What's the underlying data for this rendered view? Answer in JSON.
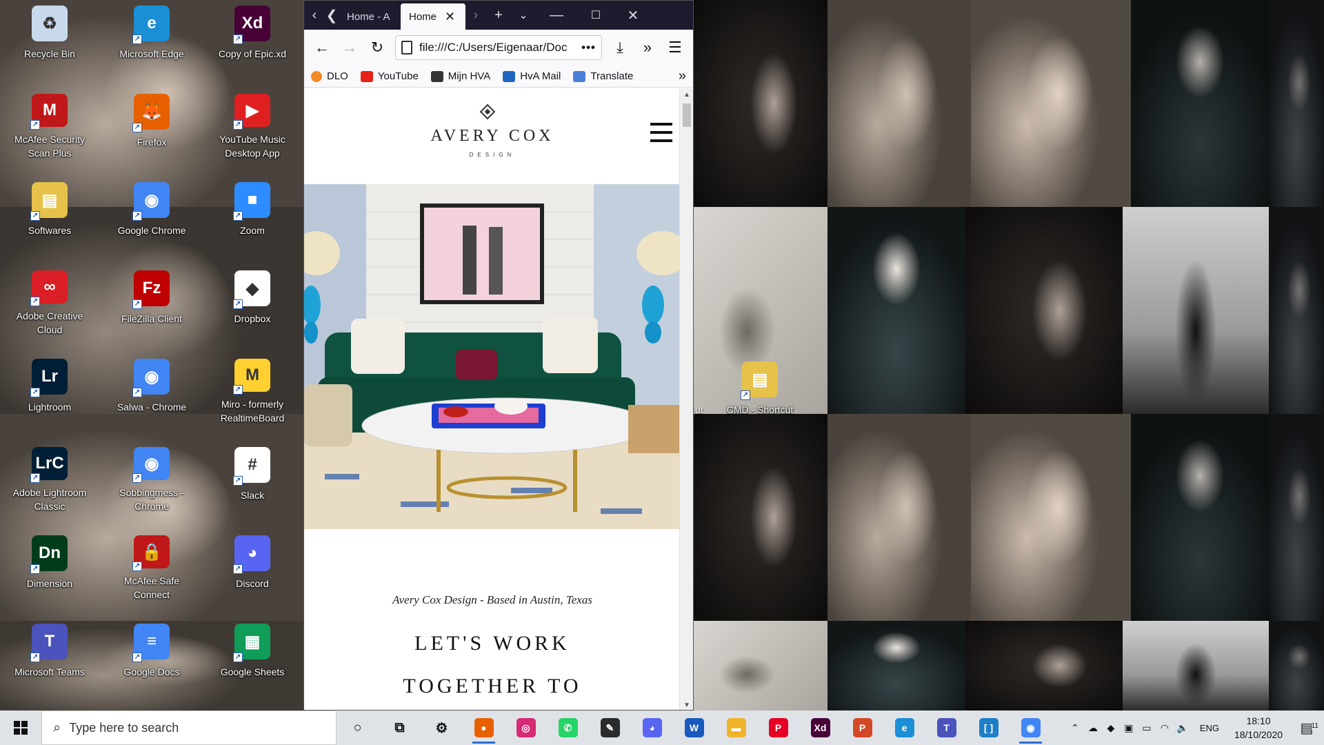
{
  "desktop": {
    "icons": [
      {
        "label": "Recycle Bin",
        "icon": "recycle-bin-icon",
        "color": "#c9d9ec",
        "glyph": "♻"
      },
      {
        "label": "Microsoft Edge",
        "icon": "edge-icon",
        "color": "#1b8fd6",
        "glyph": "e"
      },
      {
        "label": "Copy of Epic.xd",
        "icon": "xd-file-icon",
        "color": "#470137",
        "glyph": "Xd"
      },
      {
        "label": "McAfee Security Scan Plus",
        "icon": "mcafee-icon",
        "color": "#c01818",
        "glyph": "M"
      },
      {
        "label": "Firefox",
        "icon": "firefox-icon",
        "color": "#e66000",
        "glyph": "🦊"
      },
      {
        "label": "YouTube Music Desktop App",
        "icon": "youtube-music-icon",
        "color": "#e02020",
        "glyph": "▶"
      },
      {
        "label": "Softwares",
        "icon": "folder-icon",
        "color": "#e6c24a",
        "glyph": "▤"
      },
      {
        "label": "Google Chrome",
        "icon": "chrome-icon",
        "color": "#4285f4",
        "glyph": "◉"
      },
      {
        "label": "Zoom",
        "icon": "zoom-icon",
        "color": "#2d8cff",
        "glyph": "■"
      },
      {
        "label": "Adobe Creative Cloud",
        "icon": "creative-cloud-icon",
        "color": "#da1f26",
        "glyph": "∞"
      },
      {
        "label": "FileZilla Client",
        "icon": "filezilla-icon",
        "color": "#bf0000",
        "glyph": "Fz"
      },
      {
        "label": "Dropbox",
        "icon": "dropbox-icon",
        "color": "#ffffff",
        "glyph": "◆"
      },
      {
        "label": "Lightroom",
        "icon": "lightroom-icon",
        "color": "#001e36",
        "glyph": "Lr"
      },
      {
        "label": "Salwa - Chrome",
        "icon": "chrome-profile-icon",
        "color": "#4285f4",
        "glyph": "◉"
      },
      {
        "label": "Miro - formerly RealtimeBoard",
        "icon": "miro-icon",
        "color": "#ffd02f",
        "glyph": "M"
      },
      {
        "label": "Adobe Lightroom Classic",
        "icon": "lightroom-classic-icon",
        "color": "#001e36",
        "glyph": "LrC"
      },
      {
        "label": "Sobbingmess - Chrome",
        "icon": "chrome-profile-icon",
        "color": "#4285f4",
        "glyph": "◉"
      },
      {
        "label": "Slack",
        "icon": "slack-icon",
        "color": "#ffffff",
        "glyph": "#"
      },
      {
        "label": "Dimension",
        "icon": "dimension-icon",
        "color": "#003b1a",
        "glyph": "Dn"
      },
      {
        "label": "McAfee Safe Connect",
        "icon": "mcafee-safe-connect-icon",
        "color": "#c01818",
        "glyph": "🔒"
      },
      {
        "label": "Discord",
        "icon": "discord-icon",
        "color": "#5865f2",
        "glyph": "◕"
      },
      {
        "label": "Microsoft Teams",
        "icon": "teams-icon",
        "color": "#4b53bc",
        "glyph": "T"
      },
      {
        "label": "Google Docs",
        "icon": "google-docs-icon",
        "color": "#4285f4",
        "glyph": "≡"
      },
      {
        "label": "Google Sheets",
        "icon": "google-sheets-icon",
        "color": "#0f9d58",
        "glyph": "▦"
      }
    ],
    "extra_icon": {
      "label": "CMD - Shortcut",
      "icon": "folder-icon",
      "color": "#e6c24a",
      "glyph": "▤"
    },
    "partial_label": "ut"
  },
  "browser": {
    "tabs": [
      {
        "label": "Home - A"
      },
      {
        "label": "Home",
        "active": true
      }
    ],
    "url": "file:///C:/Users/Eigenaar/Doc",
    "bookmarks": [
      {
        "label": "DLO",
        "icon": "dlo-icon",
        "color": "#f08a24"
      },
      {
        "label": "YouTube",
        "icon": "youtube-icon",
        "color": "#e62117"
      },
      {
        "label": "Mijn HVA",
        "icon": "hva-icon",
        "color": "#333333"
      },
      {
        "label": "HvA Mail",
        "icon": "outlook-icon",
        "color": "#1f66c1"
      },
      {
        "label": "Translate",
        "icon": "translate-icon",
        "color": "#4a7fd8"
      }
    ]
  },
  "site": {
    "brand": "AVERY COX",
    "brand_sub": "DESIGN",
    "tagline": "Avery Cox Design - Based in Austin, Texas",
    "headline_1": "LET'S WORK",
    "headline_2": "TOGETHER TO",
    "hero_alt": "Living room with green velvet sofa and marble coffee table"
  },
  "taskbar": {
    "search_placeholder": "Type here to search",
    "apps": [
      {
        "name": "cortana-icon",
        "color": "transparent",
        "glyph": "○"
      },
      {
        "name": "task-view-icon",
        "color": "transparent",
        "glyph": "⧉"
      },
      {
        "name": "settings-icon",
        "color": "transparent",
        "glyph": "⚙"
      },
      {
        "name": "firefox-icon",
        "color": "#e66000",
        "glyph": "●",
        "running": true
      },
      {
        "name": "instagram-icon",
        "color": "#d62976",
        "glyph": "◎"
      },
      {
        "name": "whatsapp-icon",
        "color": "#25d366",
        "glyph": "✆"
      },
      {
        "name": "pen-app-icon",
        "color": "#2b2b2b",
        "glyph": "✎"
      },
      {
        "name": "discord-icon",
        "color": "#5865f2",
        "glyph": "◕"
      },
      {
        "name": "word-icon",
        "color": "#185abd",
        "glyph": "W"
      },
      {
        "name": "file-explorer-icon",
        "color": "#f0b429",
        "glyph": "▬"
      },
      {
        "name": "pinterest-icon",
        "color": "#e60023",
        "glyph": "P"
      },
      {
        "name": "xd-icon",
        "color": "#470137",
        "glyph": "Xd"
      },
      {
        "name": "powerpoint-icon",
        "color": "#d24726",
        "glyph": "P"
      },
      {
        "name": "edge-icon",
        "color": "#1b8fd6",
        "glyph": "e"
      },
      {
        "name": "teams-icon",
        "color": "#4b53bc",
        "glyph": "T"
      },
      {
        "name": "bracket-app-icon",
        "color": "#1e7fc7",
        "glyph": "[ ]"
      },
      {
        "name": "chrome-icon",
        "color": "#4285f4",
        "glyph": "◉",
        "running": true
      }
    ],
    "language": "ENG",
    "time": "18:10",
    "date": "18/10/2020",
    "notifications": "11"
  }
}
